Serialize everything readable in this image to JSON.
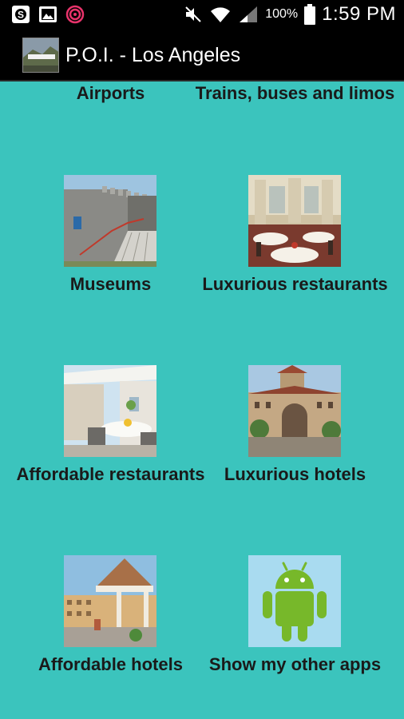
{
  "status_bar": {
    "battery_percent": "100%",
    "time": "1:59 PM",
    "icons": [
      "skype-icon",
      "gallery-icon",
      "app-notification-icon",
      "mute-icon",
      "wifi-icon",
      "signal-icon",
      "battery-icon"
    ]
  },
  "action_bar": {
    "title": "P.O.I. - Los Angeles",
    "icon": "hollywood-sign-icon"
  },
  "grid": {
    "items": [
      {
        "label": "Airports",
        "image": "airport-photo"
      },
      {
        "label": "Trains, buses and limos",
        "image": "train-photo"
      },
      {
        "label": "Museums",
        "image": "museum-photo"
      },
      {
        "label": "Luxurious restaurants",
        "image": "luxury-restaurant-photo"
      },
      {
        "label": "Affordable restaurants",
        "image": "affordable-restaurant-photo"
      },
      {
        "label": "Luxurious hotels",
        "image": "luxury-hotel-photo"
      },
      {
        "label": "Affordable hotels",
        "image": "affordable-hotel-photo"
      },
      {
        "label": "Show my other apps",
        "image": "android-robot-icon"
      }
    ]
  },
  "colors": {
    "background": "#3bc4bd",
    "bars": "#000000",
    "label_text": "#1a1a1a",
    "android_green": "#77b82a"
  }
}
